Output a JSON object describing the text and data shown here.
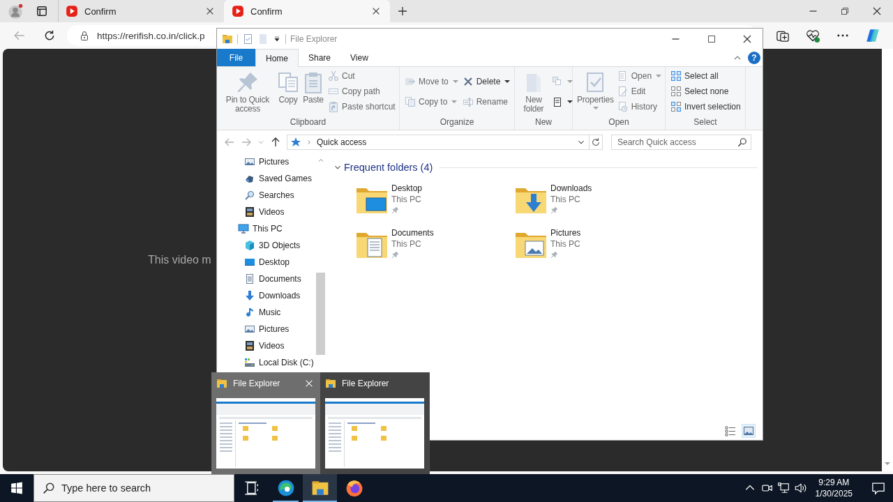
{
  "browser": {
    "tabs": [
      {
        "title": "Confirm",
        "selected": false
      },
      {
        "title": "Confirm",
        "selected": true
      }
    ],
    "address": "https://rerifish.co.in/click.p",
    "page_text": "This video m"
  },
  "explorer": {
    "title": "File Explorer",
    "ribbon_tabs": [
      {
        "label": "File",
        "kind": "file",
        "selected": false
      },
      {
        "label": "Home",
        "kind": "tab",
        "selected": true
      },
      {
        "label": "Share",
        "kind": "tab",
        "selected": false
      },
      {
        "label": "View",
        "kind": "tab",
        "selected": false
      }
    ],
    "help_label": "?",
    "ribbon_groups": [
      {
        "label": "Clipboard",
        "columns": [
          [
            {
              "label": "Pin to Quick access",
              "kind": "large",
              "disabled": true,
              "dropdown": false
            }
          ],
          [
            {
              "label": "Copy",
              "kind": "large",
              "disabled": true,
              "dropdown": false
            }
          ],
          [
            {
              "label": "Paste",
              "kind": "large",
              "disabled": true,
              "dropdown": false
            }
          ],
          [
            {
              "label": "Cut",
              "kind": "small",
              "disabled": true,
              "dropdown": false
            },
            {
              "label": "Copy path",
              "kind": "small",
              "disabled": true,
              "dropdown": false
            },
            {
              "label": "Paste shortcut",
              "kind": "small",
              "disabled": true,
              "dropdown": false
            }
          ]
        ]
      },
      {
        "label": "Organize",
        "columns": [
          [
            {
              "label": "Move to",
              "kind": "small",
              "disabled": true,
              "dropdown": true
            },
            {
              "label": "Copy to",
              "kind": "small",
              "disabled": true,
              "dropdown": true
            }
          ],
          [
            {
              "label": "Delete",
              "kind": "small",
              "disabled": false,
              "dropdown": true
            },
            {
              "label": "Rename",
              "kind": "small",
              "disabled": true,
              "dropdown": false
            }
          ]
        ]
      },
      {
        "label": "New",
        "columns": [
          [
            {
              "label": "New folder",
              "kind": "large",
              "disabled": true,
              "dropdown": false
            }
          ],
          [
            {
              "kind": "icon",
              "disabled": true,
              "dropdown": true
            },
            {
              "kind": "icon",
              "disabled": false,
              "dropdown": true
            }
          ]
        ]
      },
      {
        "label": "Open",
        "columns": [
          [
            {
              "label": "Properties",
              "kind": "large",
              "disabled": true,
              "dropdown": true
            }
          ],
          [
            {
              "label": "Open",
              "kind": "small",
              "disabled": true,
              "dropdown": true
            },
            {
              "label": "Edit",
              "kind": "small",
              "disabled": true,
              "dropdown": false
            },
            {
              "label": "History",
              "kind": "small",
              "disabled": true,
              "dropdown": false
            }
          ]
        ]
      },
      {
        "label": "Select",
        "columns": [
          [
            {
              "label": "Select all",
              "kind": "small",
              "disabled": false,
              "dropdown": false
            },
            {
              "label": "Select none",
              "kind": "small",
              "disabled": false,
              "dropdown": false
            },
            {
              "label": "Invert selection",
              "kind": "small",
              "disabled": false,
              "dropdown": false
            }
          ]
        ]
      }
    ],
    "location": "Quick access",
    "search_placeholder": "Search Quick access",
    "nav_pane": {
      "items": [
        {
          "children": [
            {
              "label": "Pictures"
            },
            {
              "label": "Saved Games"
            },
            {
              "label": "Searches"
            },
            {
              "label": "Videos"
            }
          ]
        },
        {
          "label": "This PC",
          "children": [
            {
              "label": "3D Objects"
            },
            {
              "label": "Desktop"
            },
            {
              "label": "Documents"
            },
            {
              "label": "Downloads"
            },
            {
              "label": "Music"
            },
            {
              "label": "Pictures"
            },
            {
              "label": "Videos"
            },
            {
              "label": "Local Disk (C:)"
            }
          ]
        }
      ]
    },
    "sections": [
      {
        "title": "Frequent folders (4)",
        "expanded": true,
        "items": [
          {
            "name": "Desktop",
            "location": "This PC",
            "pinned": true
          },
          {
            "name": "Downloads",
            "location": "This PC",
            "pinned": true
          },
          {
            "name": "Documents",
            "location": "This PC",
            "pinned": true
          },
          {
            "name": "Pictures",
            "location": "This PC",
            "pinned": true
          }
        ]
      }
    ],
    "view_modes": [
      {
        "selected": false
      },
      {
        "selected": true
      }
    ]
  },
  "previews": [
    {
      "title": "File Explorer",
      "hovered": true
    },
    {
      "title": "File Explorer",
      "hovered": false
    }
  ],
  "taskbar": {
    "search_placeholder": "Type here to search",
    "apps": [
      {
        "running": true,
        "active": false
      },
      {
        "running": true,
        "active": true
      },
      {
        "running": false,
        "active": false
      }
    ],
    "time": "9:29 AM",
    "date": "1/30/2025"
  }
}
